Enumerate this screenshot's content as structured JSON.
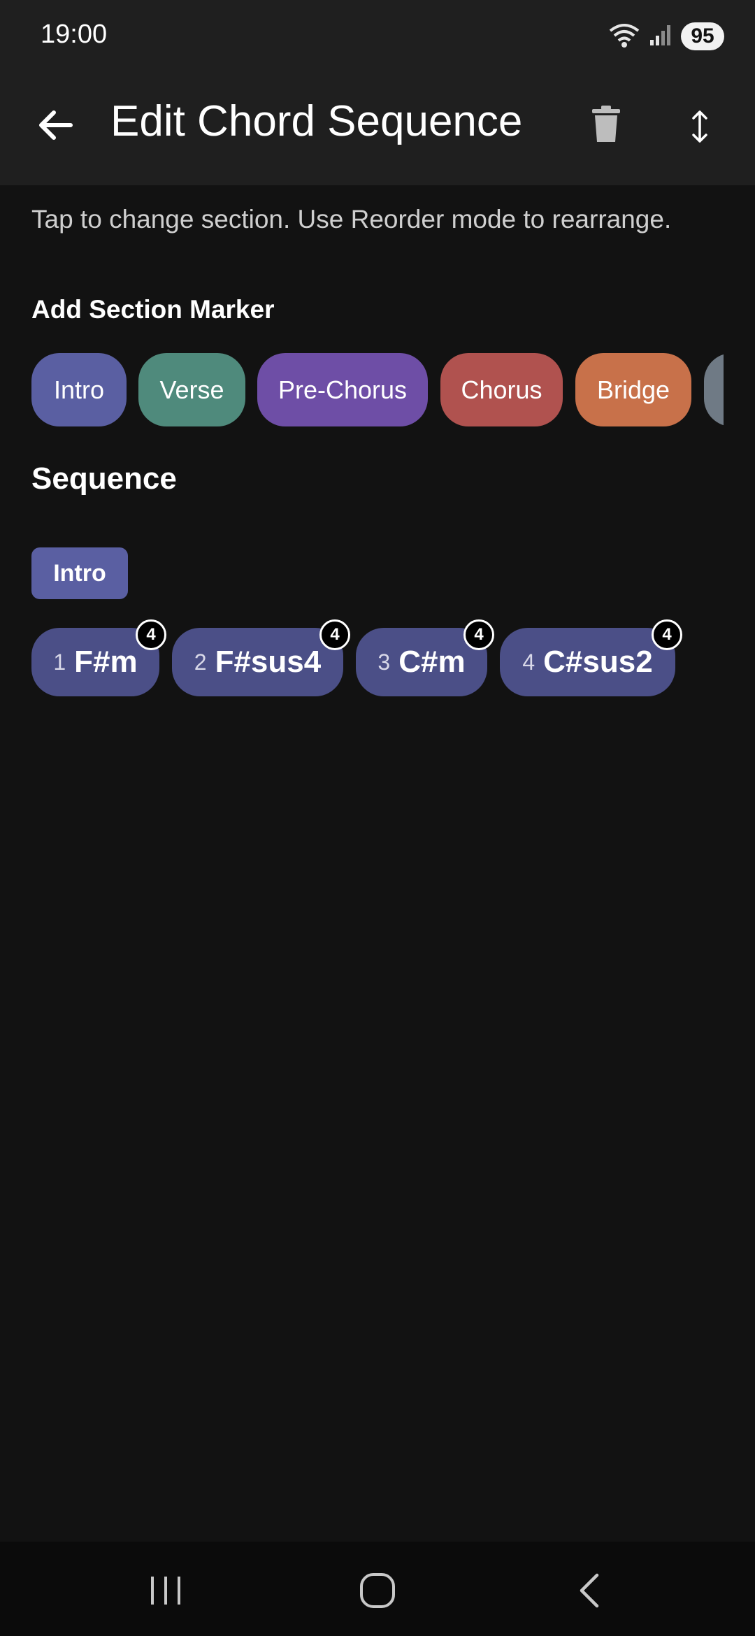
{
  "status_bar": {
    "time": "19:00",
    "battery": "95",
    "icons": [
      "wifi-icon",
      "signal-icon",
      "battery-icon"
    ]
  },
  "app_bar": {
    "title": "Edit Chord Sequence",
    "icons": [
      "arrow-back-icon",
      "trash-icon",
      "reorder-arrows-icon"
    ]
  },
  "hint": "Tap to change section. Use Reorder mode to rearrange.",
  "section_markers": {
    "heading": "Add Section Marker",
    "items": [
      {
        "label": "Intro",
        "color": "#5a5fa2"
      },
      {
        "label": "Verse",
        "color": "#4f8a7c"
      },
      {
        "label": "Pre-Chorus",
        "color": "#6e4ea6"
      },
      {
        "label": "Chorus",
        "color": "#b0524f"
      },
      {
        "label": "Bridge",
        "color": "#c8714a"
      },
      {
        "label": "",
        "color": "#6f7a85"
      }
    ]
  },
  "sequence": {
    "heading": "Sequence",
    "section_tag": "Intro",
    "chords": [
      {
        "index": "1",
        "name": "F#m",
        "beats": "4"
      },
      {
        "index": "2",
        "name": "F#sus4",
        "beats": "4"
      },
      {
        "index": "3",
        "name": "C#m",
        "beats": "4"
      },
      {
        "index": "4",
        "name": "C#sus2",
        "beats": "4"
      }
    ]
  },
  "nav_bar": {
    "icons": [
      "recent-apps-icon",
      "home-icon",
      "back-icon"
    ]
  },
  "colors": {
    "background": "#121212",
    "app_bar": "#1f1f1f",
    "chord_chip": "#4b4f87"
  }
}
